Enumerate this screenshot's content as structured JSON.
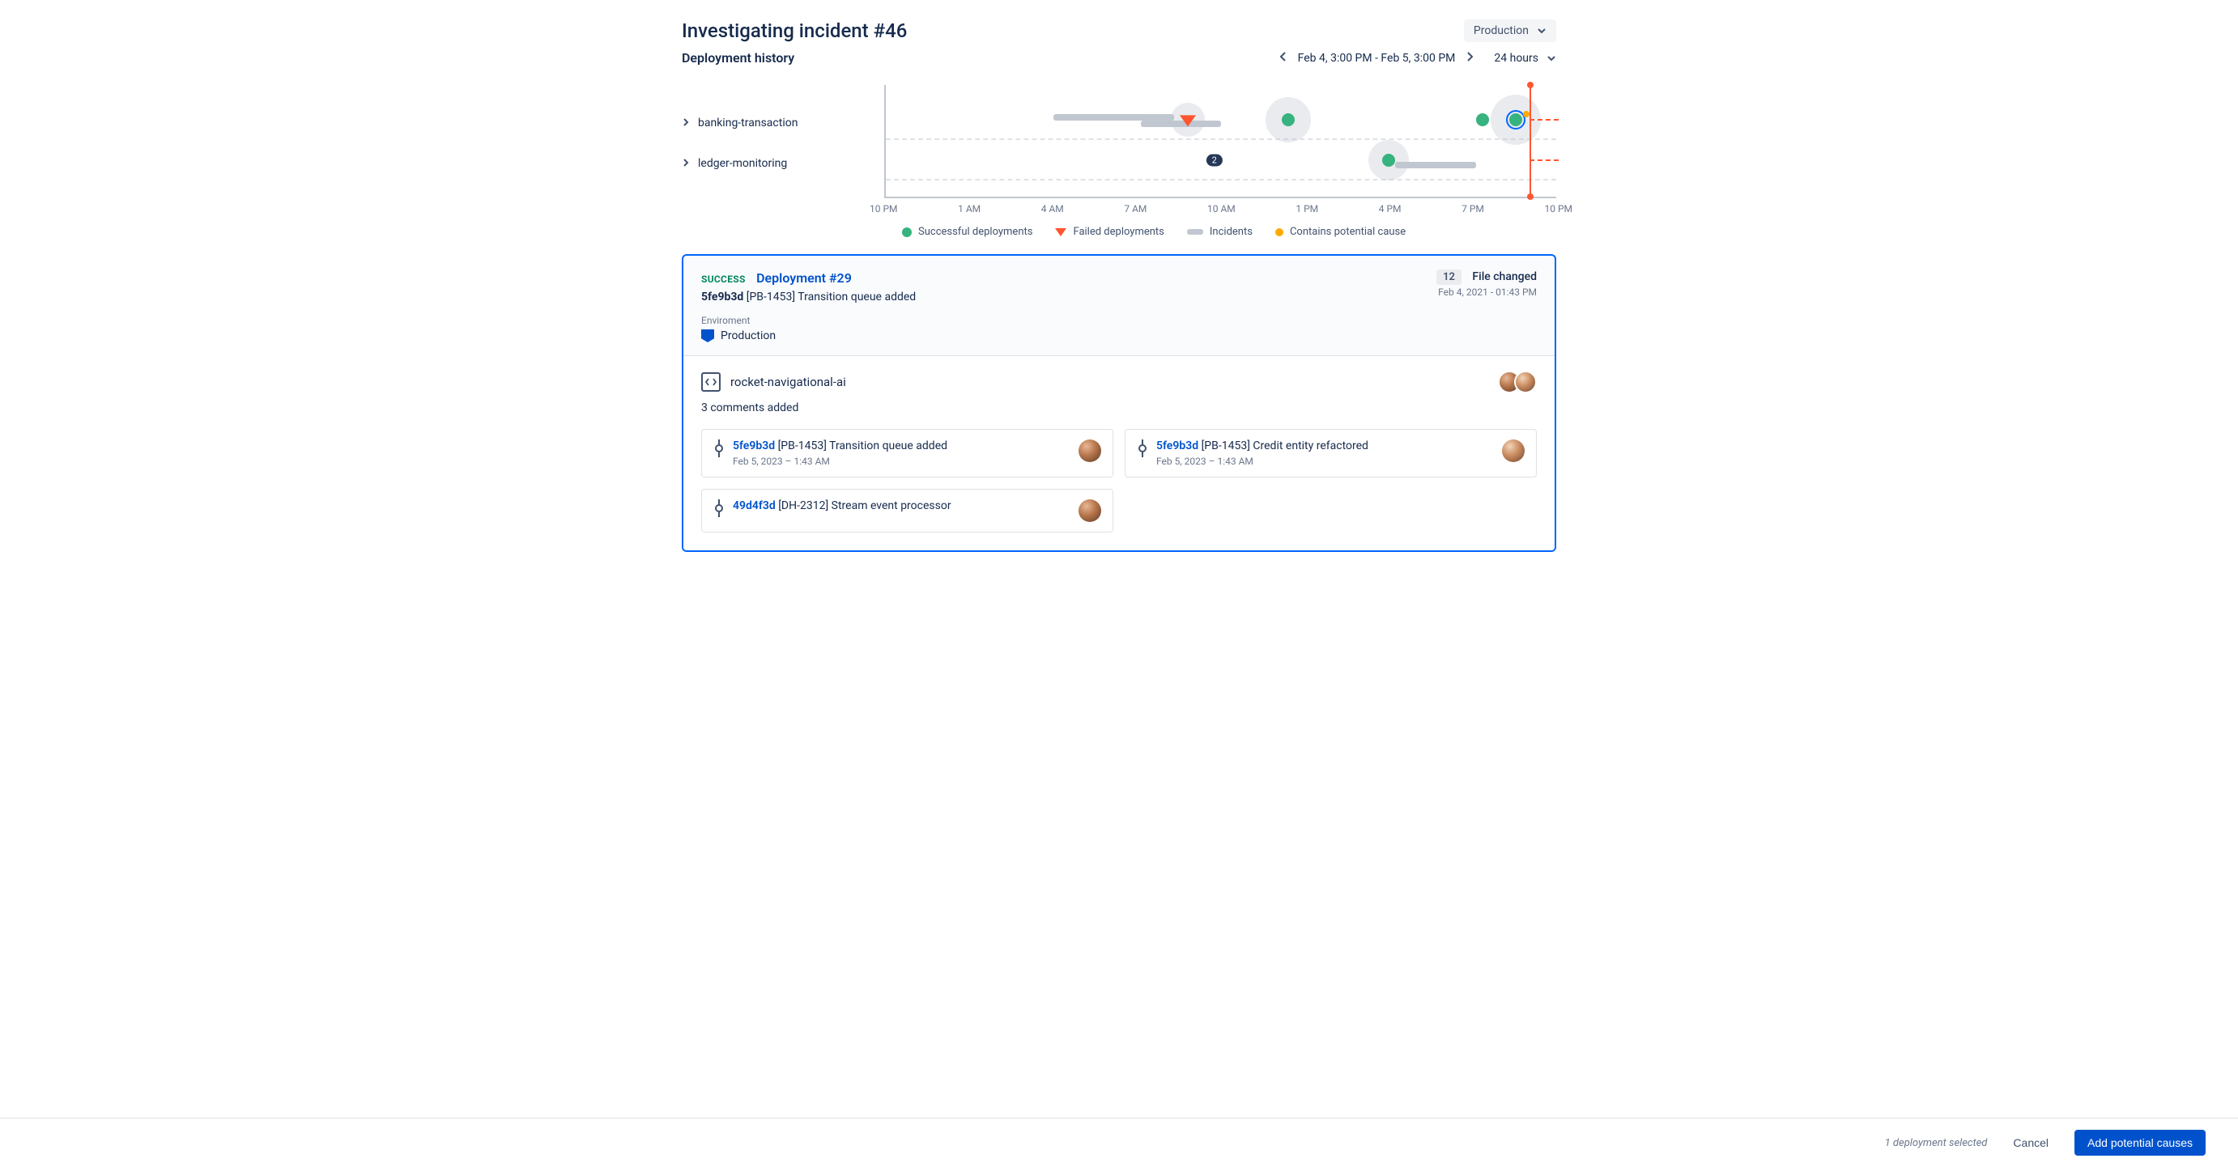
{
  "header": {
    "title": "Investigating incident #46",
    "env_selector": "Production"
  },
  "subheader": {
    "label": "Deployment history",
    "date_range": "Feb 4, 3:00 PM - Feb 5, 3:00 PM",
    "time_window": "24 hours"
  },
  "timeline": {
    "lanes": [
      "banking-transaction",
      "ledger-monitoring"
    ],
    "ticks": [
      "10 PM",
      "1 AM",
      "4 AM",
      "7 AM",
      "10 AM",
      "1 PM",
      "4 PM",
      "7 PM",
      "10 PM"
    ],
    "cluster_badge": "2",
    "legend": {
      "success": "Successful deployments",
      "failed": "Failed deployments",
      "incidents": "Incidents",
      "cause": "Contains potential cause"
    }
  },
  "chart_data": {
    "type": "scatter",
    "x_axis": {
      "start": "10 PM (Feb 4)",
      "end": "10 PM (Feb 5)",
      "ticks": [
        "10 PM",
        "1 AM",
        "4 AM",
        "7 AM",
        "10 AM",
        "1 PM",
        "4 PM",
        "7 PM",
        "10 PM"
      ]
    },
    "series": [
      {
        "name": "banking-transaction",
        "events": [
          {
            "kind": "incident_bar",
            "start_pct": 25,
            "end_pct": 43
          },
          {
            "kind": "incident_bar",
            "start_pct": 38,
            "end_pct": 50
          },
          {
            "kind": "failed_deployment",
            "x_pct": 45,
            "halo": true
          },
          {
            "kind": "successful_deployment",
            "x_pct": 60,
            "halo": true
          },
          {
            "kind": "successful_deployment",
            "x_pct": 89
          },
          {
            "kind": "successful_deployment",
            "x_pct": 94,
            "selected": true,
            "contains_potential_cause": true,
            "halo": true
          }
        ]
      },
      {
        "name": "ledger-monitoring",
        "events": [
          {
            "kind": "cluster_badge",
            "x_pct": 49,
            "count": 2
          },
          {
            "kind": "successful_deployment",
            "x_pct": 75,
            "halo": true
          },
          {
            "kind": "incident_bar",
            "start_pct": 76,
            "end_pct": 88
          }
        ]
      }
    ],
    "current_time_marker_pct": 96
  },
  "deployment": {
    "status": "SUCCESS",
    "name": "Deployment #29",
    "commit_hash": "5fe9b3d",
    "issue_key": "[PB-1453]",
    "commit_msg": "Transition queue added",
    "file_count": "12",
    "file_changed_label": "File changed",
    "timestamp": "Feb 4, 2021 - 01:43 PM",
    "env_label": "Enviroment",
    "env_value": "Production",
    "repo_name": "rocket-navigational-ai",
    "comments_line": "3 comments added",
    "commits": [
      {
        "hash": "5fe9b3d",
        "key": "[PB-1453]",
        "msg": "Transition queue added",
        "time": "Feb 5, 2023 – 1:43 AM"
      },
      {
        "hash": "5fe9b3d",
        "key": "[PB-1453]",
        "msg": "Credit entity refactored",
        "time": "Feb 5, 2023 – 1:43 AM"
      },
      {
        "hash": "49d4f3d",
        "key": "[DH-2312]",
        "msg": "Stream event processor",
        "time": ""
      }
    ]
  },
  "footer": {
    "hint": "1 deployment selected",
    "cancel": "Cancel",
    "primary": "Add potential causes"
  },
  "avatar_gradients": [
    "radial-gradient(circle at 35% 30%, #e8b896 0%, #b5744a 45%, #5d3a28 100%)",
    "radial-gradient(circle at 35% 30%, #f2d4b8 0%, #c98a5e 45%, #6b4530 100%)"
  ]
}
